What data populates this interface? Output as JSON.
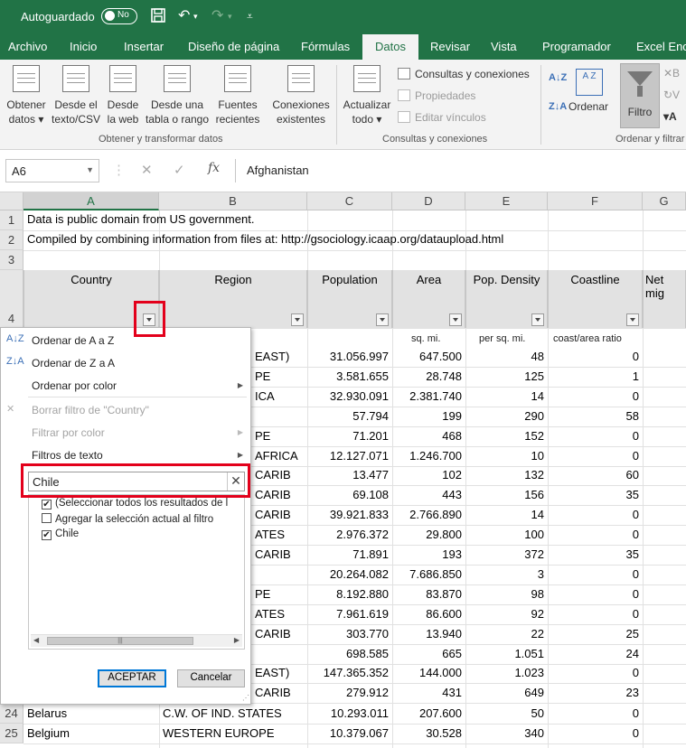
{
  "titlebar": {
    "autosave_label": "Autoguardado",
    "toggle_state": "No",
    "save_icon": "save-icon",
    "undo_icon": "undo-icon",
    "redo_icon": "redo-icon"
  },
  "tabs": [
    "Archivo",
    "Inicio",
    "Insertar",
    "Diseño de página",
    "Fórmulas",
    "Datos",
    "Revisar",
    "Vista",
    "Programador",
    "Excel Encr"
  ],
  "active_tab": "Datos",
  "ribbon": {
    "get_data": {
      "line1": "Obtener",
      "line2": "datos ▾"
    },
    "from_text": {
      "line1": "Desde el",
      "line2": "texto/CSV"
    },
    "from_web": {
      "line1": "Desde",
      "line2": "la web"
    },
    "from_table": {
      "line1": "Desde una",
      "line2": "tabla o rango"
    },
    "recent_sources": {
      "line1": "Fuentes",
      "line2": "recientes"
    },
    "existing_connections": {
      "line1": "Conexiones",
      "line2": "existentes"
    },
    "group1_label": "Obtener y transformar datos",
    "refresh_all": {
      "line1": "Actualizar",
      "line2": "todo ▾"
    },
    "queries_connections": "Consultas y conexiones",
    "properties": "Propiedades",
    "edit_links": "Editar vínculos",
    "group2_label": "Consultas y conexiones",
    "sort_az": "A Z",
    "sort": "Ordenar",
    "filter": "Filtro",
    "group3_label": "Ordenar y filtrar"
  },
  "formula_bar": {
    "name_box": "A6",
    "cancel": "✕",
    "enter": "✓",
    "fx": "fx",
    "value": "Afghanistan"
  },
  "columns": [
    "A",
    "B",
    "C",
    "D",
    "E",
    "F",
    "G"
  ],
  "rows": {
    "r1": "Data is public domain from US government.",
    "r2": "Compiled by combining information from files at: http://gsociology.icaap.org/dataupload.html",
    "headers": [
      "Country",
      "Region",
      "Population",
      "Area",
      "Pop. Density",
      "Coastline",
      "Net mig"
    ],
    "units": {
      "area": "sq. mi.",
      "density": "per sq. mi.",
      "coast": "coast/area ratio"
    }
  },
  "row_numbers": [
    "1",
    "2",
    "3",
    "4",
    "24",
    "25"
  ],
  "data_rows": [
    {
      "region": "EAST)",
      "pop": "31.056.997",
      "area": "647.500",
      "dens": "48",
      "coast": "0"
    },
    {
      "region": "PE",
      "pop": "3.581.655",
      "area": "28.748",
      "dens": "125",
      "coast": "1"
    },
    {
      "region": "ICA",
      "pop": "32.930.091",
      "area": "2.381.740",
      "dens": "14",
      "coast": "0"
    },
    {
      "region": "",
      "pop": "57.794",
      "area": "199",
      "dens": "290",
      "coast": "58"
    },
    {
      "region": "PE",
      "pop": "71.201",
      "area": "468",
      "dens": "152",
      "coast": "0"
    },
    {
      "region": "AFRICA",
      "pop": "12.127.071",
      "area": "1.246.700",
      "dens": "10",
      "coast": "0"
    },
    {
      "region": "CARIB",
      "pop": "13.477",
      "area": "102",
      "dens": "132",
      "coast": "60"
    },
    {
      "region": "CARIB",
      "pop": "69.108",
      "area": "443",
      "dens": "156",
      "coast": "35"
    },
    {
      "region": "CARIB",
      "pop": "39.921.833",
      "area": "2.766.890",
      "dens": "14",
      "coast": "0"
    },
    {
      "region": "ATES",
      "pop": "2.976.372",
      "area": "29.800",
      "dens": "100",
      "coast": "0"
    },
    {
      "region": "CARIB",
      "pop": "71.891",
      "area": "193",
      "dens": "372",
      "coast": "35"
    },
    {
      "region": "",
      "pop": "20.264.082",
      "area": "7.686.850",
      "dens": "3",
      "coast": "0"
    },
    {
      "region": "PE",
      "pop": "8.192.880",
      "area": "83.870",
      "dens": "98",
      "coast": "0"
    },
    {
      "region": "ATES",
      "pop": "7.961.619",
      "area": "86.600",
      "dens": "92",
      "coast": "0"
    },
    {
      "region": "CARIB",
      "pop": "303.770",
      "area": "13.940",
      "dens": "22",
      "coast": "25"
    },
    {
      "region": "",
      "pop": "698.585",
      "area": "665",
      "dens": "1.051",
      "coast": "24"
    },
    {
      "region": "EAST)",
      "pop": "147.365.352",
      "area": "144.000",
      "dens": "1.023",
      "coast": "0"
    },
    {
      "region": "CARIB",
      "pop": "279.912",
      "area": "431",
      "dens": "649",
      "coast": "23"
    }
  ],
  "full_rows": [
    {
      "num": "24",
      "country": "Belarus",
      "region": "C.W. OF IND. STATES",
      "pop": "10.293.011",
      "area": "207.600",
      "dens": "50",
      "coast": "0"
    },
    {
      "num": "25",
      "country": "Belgium",
      "region": "WESTERN EUROPE",
      "pop": "10.379.067",
      "area": "30.528",
      "dens": "340",
      "coast": "0"
    }
  ],
  "filter_menu": {
    "sort_asc": "Ordenar de A a Z",
    "sort_desc": "Ordenar de Z a A",
    "sort_color": "Ordenar por color",
    "clear_filter": "Borrar filtro de \"Country\"",
    "filter_color": "Filtrar por color",
    "text_filters": "Filtros de texto",
    "search_value": "Chile",
    "search_clear": "✕",
    "list": [
      {
        "label": "(Seleccionar todos los resultados de l",
        "checked": true
      },
      {
        "label": "Agregar la selección actual al filtro",
        "checked": false
      },
      {
        "label": "Chile",
        "checked": true
      }
    ],
    "ok": "ACEPTAR",
    "cancel": "Cancelar"
  },
  "colors": {
    "brand": "#217346",
    "highlight": "#e3001b"
  }
}
